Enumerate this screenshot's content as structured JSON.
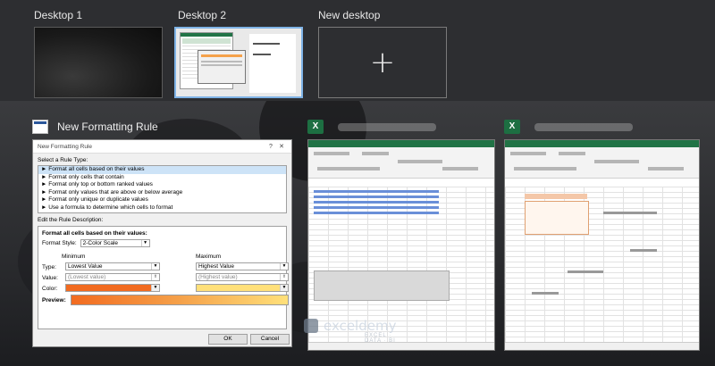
{
  "desktops": {
    "items": [
      {
        "label": "Desktop 1"
      },
      {
        "label": "Desktop 2"
      },
      {
        "label": "New desktop"
      }
    ],
    "new_icon": "plus-icon"
  },
  "windows": {
    "dialog_window": {
      "card_title": "New Formatting Rule",
      "dialog": {
        "title": "New Formatting Rule",
        "help": "?",
        "close": "✕",
        "select_type_label": "Select a Rule Type:",
        "rule_types": [
          "► Format all cells based on their values",
          "► Format only cells that contain",
          "► Format only top or bottom ranked values",
          "► Format only values that are above or below average",
          "► Format only unique or duplicate values",
          "► Use a formula to determine which cells to format"
        ],
        "edit_desc_label": "Edit the Rule Description:",
        "format_all_label": "Format all cells based on their values:",
        "format_style_label": "Format Style:",
        "format_style_value": "2-Color Scale",
        "minimum_label": "Minimum",
        "maximum_label": "Maximum",
        "type_label": "Type:",
        "value_label": "Value:",
        "color_label": "Color:",
        "min_type": "Lowest Value",
        "max_type": "Highest Value",
        "min_value": "(Lowest value)",
        "max_value": "(Highest value)",
        "min_color": "#f26b20",
        "max_color": "#ffe07a",
        "preview_label": "Preview:",
        "ok_label": "OK",
        "cancel_label": "Cancel"
      }
    },
    "excel_icon": "X"
  },
  "watermark": {
    "name": "exceldemy",
    "sub": "EXCEL · DATA · BI"
  }
}
